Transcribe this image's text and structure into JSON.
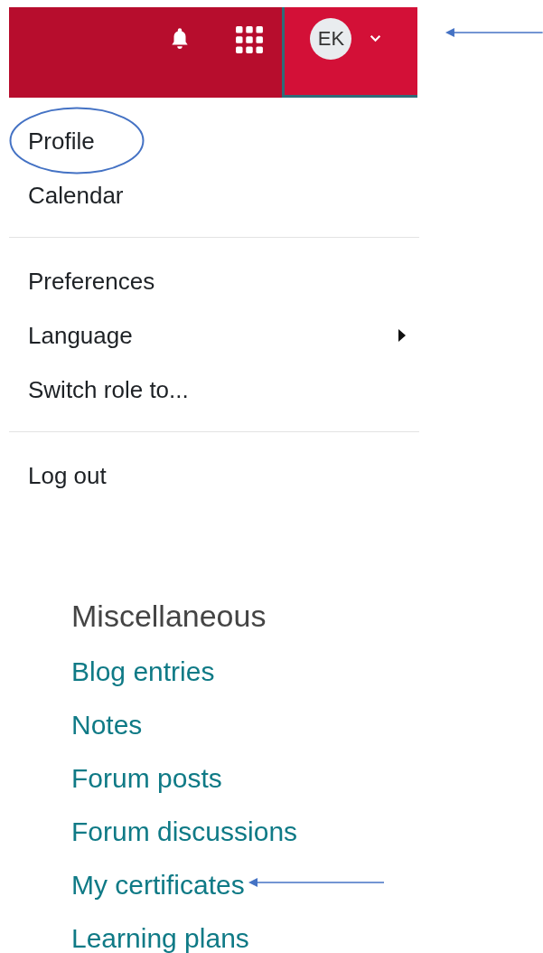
{
  "topbar": {
    "avatar": {
      "initials": "EK",
      "arrow": true
    }
  },
  "menu": {
    "groups": [
      {
        "items": [
          {
            "label": "Profile",
            "circled": true,
            "submenu": false
          },
          {
            "label": "Calendar",
            "circled": false,
            "submenu": false
          }
        ]
      },
      {
        "items": [
          {
            "label": "Preferences",
            "circled": false,
            "submenu": false
          },
          {
            "label": "Language",
            "circled": false,
            "submenu": true
          },
          {
            "label": "Switch role to...",
            "circled": false,
            "submenu": false
          }
        ]
      },
      {
        "items": [
          {
            "label": "Log out",
            "circled": false,
            "submenu": false
          }
        ]
      }
    ]
  },
  "miscellaneous": {
    "heading": "Miscellaneous",
    "links": [
      {
        "label": "Blog entries",
        "arrow": false
      },
      {
        "label": "Notes",
        "arrow": false
      },
      {
        "label": "Forum posts",
        "arrow": false
      },
      {
        "label": "Forum discussions",
        "arrow": false
      },
      {
        "label": "My certificates",
        "arrow": true
      },
      {
        "label": "Learning plans",
        "arrow": false
      }
    ]
  }
}
